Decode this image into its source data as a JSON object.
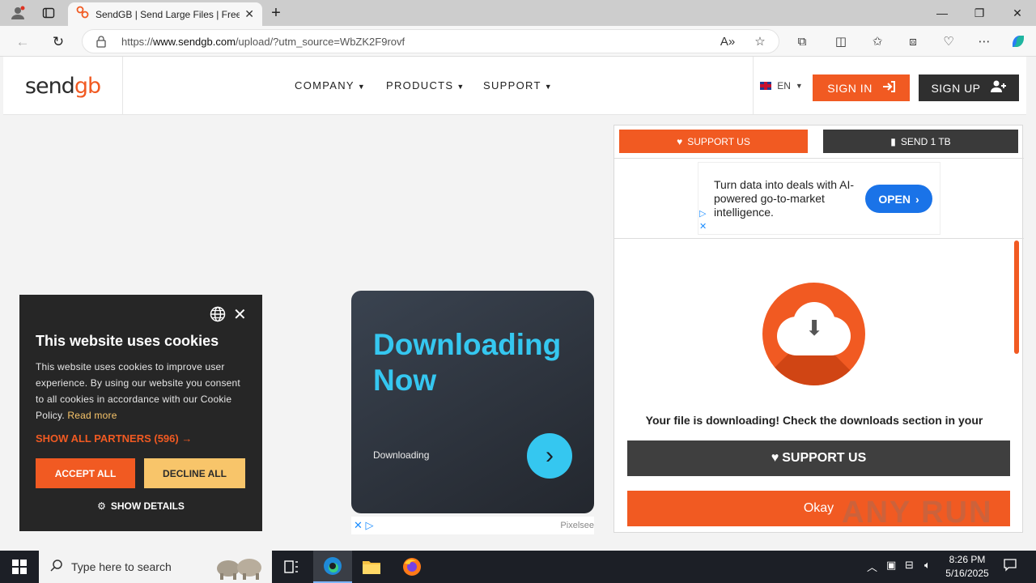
{
  "browser": {
    "tab_title": "SendGB | Send Large Files | Free file",
    "url_prefix": "https://",
    "url_domain": "www.sendgb.com",
    "url_path": "/upload/?utm_source=WbZK2F9rovf"
  },
  "site": {
    "logo_text": "send",
    "logo_accent": "gb",
    "menu": [
      {
        "label": "COMPANY"
      },
      {
        "label": "PRODUCTS"
      },
      {
        "label": "SUPPORT"
      }
    ],
    "language": "EN",
    "signin_label": "SIGN IN",
    "signup_label": "SIGN UP"
  },
  "right_panel": {
    "support_us_label": "SUPPORT US",
    "send_label": "SEND 1 TB",
    "ad_text": "Turn data into deals with AI-powered go-to-market intelligence.",
    "ad_button": "OPEN",
    "download_message": "Your file is downloading! Check the downloads section in your",
    "support_big_label": "SUPPORT US",
    "okay_label": "Okay"
  },
  "center_ad": {
    "title": "Downloading Now",
    "subtitle": "Downloading",
    "brand": "Pixelsee"
  },
  "cookie": {
    "title": "This website uses cookies",
    "body": "This website uses cookies to improve user experience. By using our website you consent to all cookies in accordance with our Cookie Policy.",
    "read_more": "Read more",
    "partners": "SHOW ALL PARTNERS (596) →",
    "accept": "ACCEPT ALL",
    "decline": "DECLINE ALL",
    "details": "SHOW DETAILS"
  },
  "taskbar": {
    "search_placeholder": "Type here to search",
    "time": "8:26 PM",
    "date": "5/16/2025"
  },
  "watermark": "ANY RUN",
  "colors": {
    "brand_orange": "#f15a22",
    "dark": "#2f2f2f",
    "ad_cyan": "#35c7f0",
    "cookie_yellow": "#f8c56a"
  }
}
